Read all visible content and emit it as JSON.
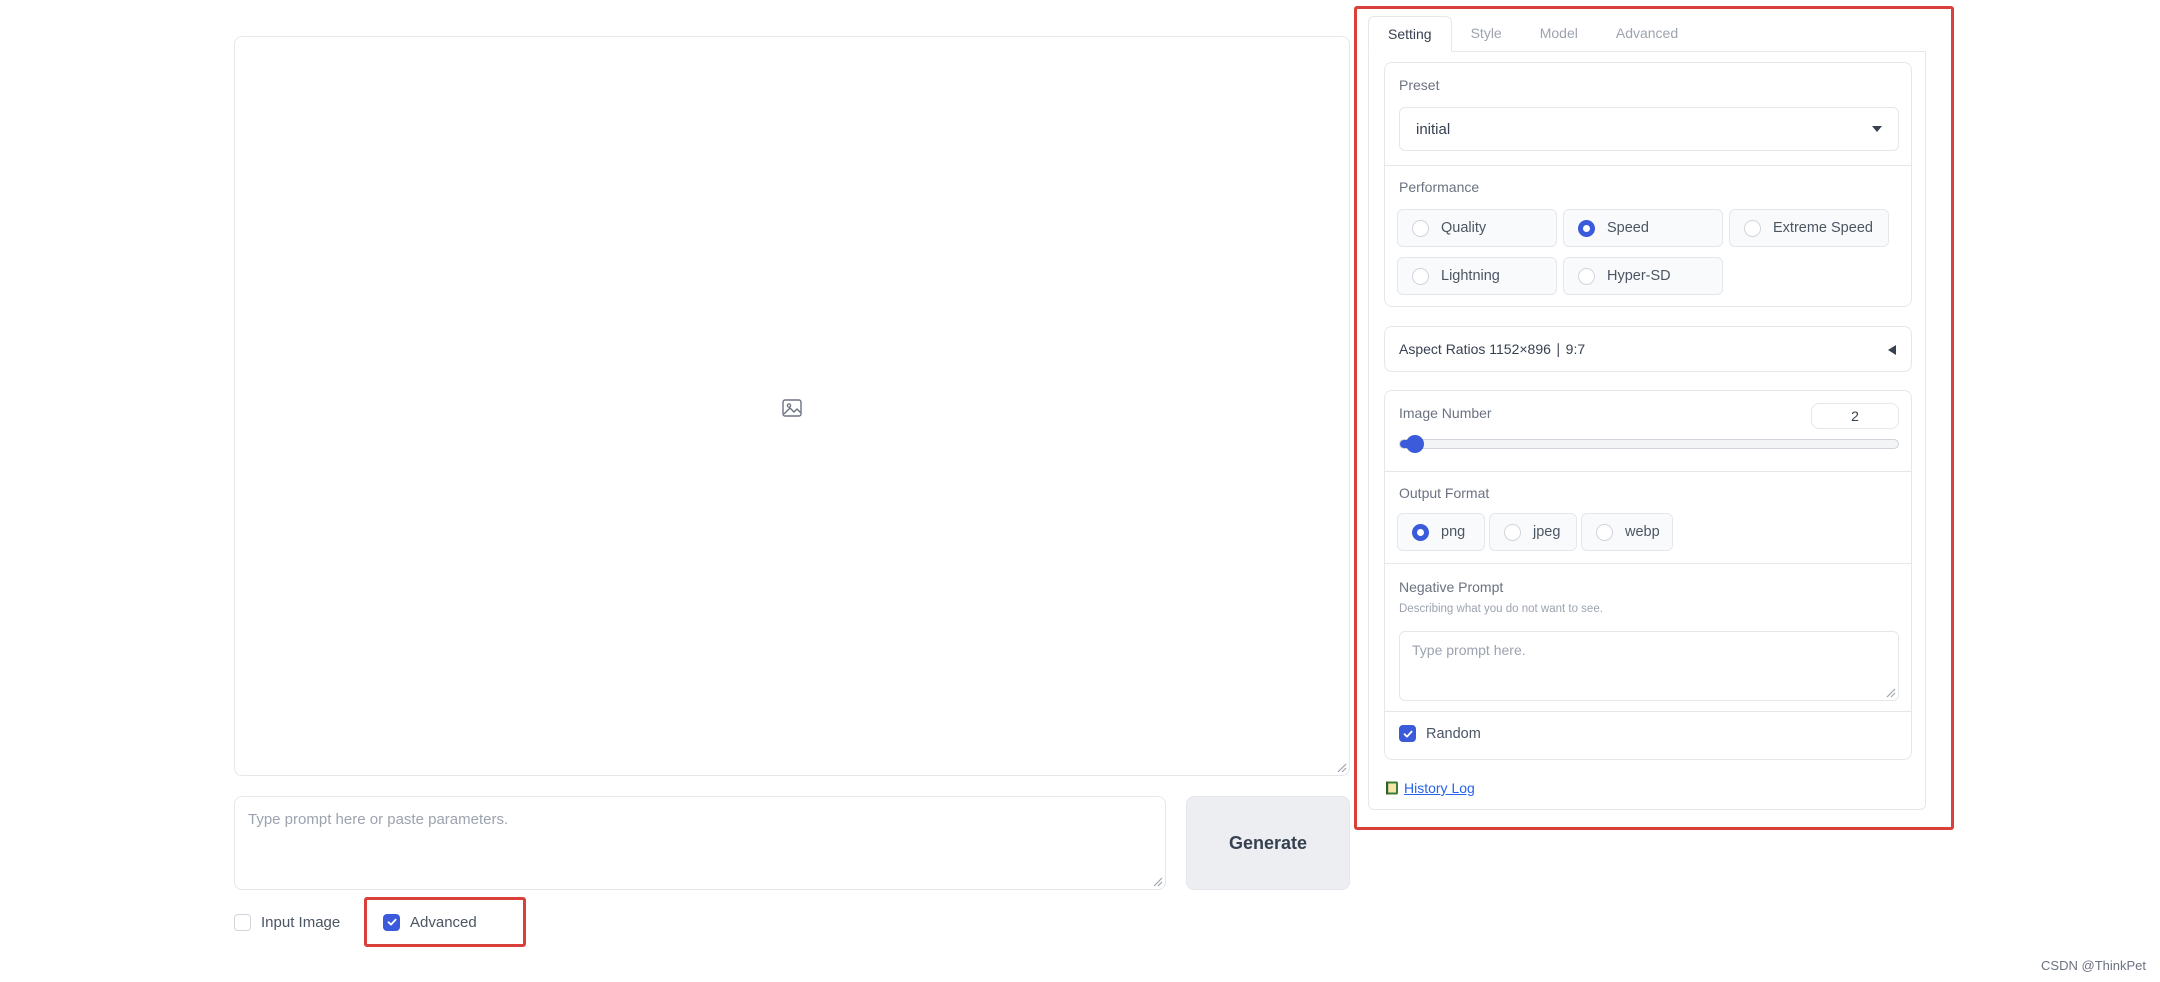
{
  "prompt": {
    "placeholder": "Type prompt here or paste parameters.",
    "value": ""
  },
  "generate_button": {
    "label": "Generate"
  },
  "bottom_options": {
    "input_image": {
      "label": "Input Image",
      "checked": false
    },
    "advanced": {
      "label": "Advanced",
      "checked": true
    }
  },
  "tabs": [
    {
      "label": "Setting",
      "active": true
    },
    {
      "label": "Style",
      "active": false
    },
    {
      "label": "Model",
      "active": false
    },
    {
      "label": "Advanced",
      "active": false
    }
  ],
  "preset": {
    "label": "Preset",
    "selected": "initial"
  },
  "performance": {
    "label": "Performance",
    "options": [
      {
        "label": "Quality",
        "checked": false
      },
      {
        "label": "Speed",
        "checked": true
      },
      {
        "label": "Extreme Speed",
        "checked": false
      },
      {
        "label": "Lightning",
        "checked": false
      },
      {
        "label": "Hyper-SD",
        "checked": false
      }
    ]
  },
  "aspect_ratios": {
    "label": "Aspect Ratios 1152×896 ∣ 9:7"
  },
  "image_number": {
    "label": "Image Number",
    "value": "2",
    "slider_fraction": 0.03
  },
  "output_format": {
    "label": "Output Format",
    "options": [
      {
        "label": "png",
        "checked": true
      },
      {
        "label": "jpeg",
        "checked": false
      },
      {
        "label": "webp",
        "checked": false
      }
    ]
  },
  "negative_prompt": {
    "label": "Negative Prompt",
    "description": "Describing what you do not want to see.",
    "placeholder": "Type prompt here.",
    "value": ""
  },
  "random": {
    "label": "Random",
    "checked": true
  },
  "history_log": {
    "label": "History Log",
    "icon": "notebook-icon"
  },
  "watermark": {
    "text": "CSDN @ThinkPet"
  },
  "colors": {
    "accent": "#3b5bdb",
    "highlight_border": "#d9403a",
    "link": "#2563eb"
  }
}
